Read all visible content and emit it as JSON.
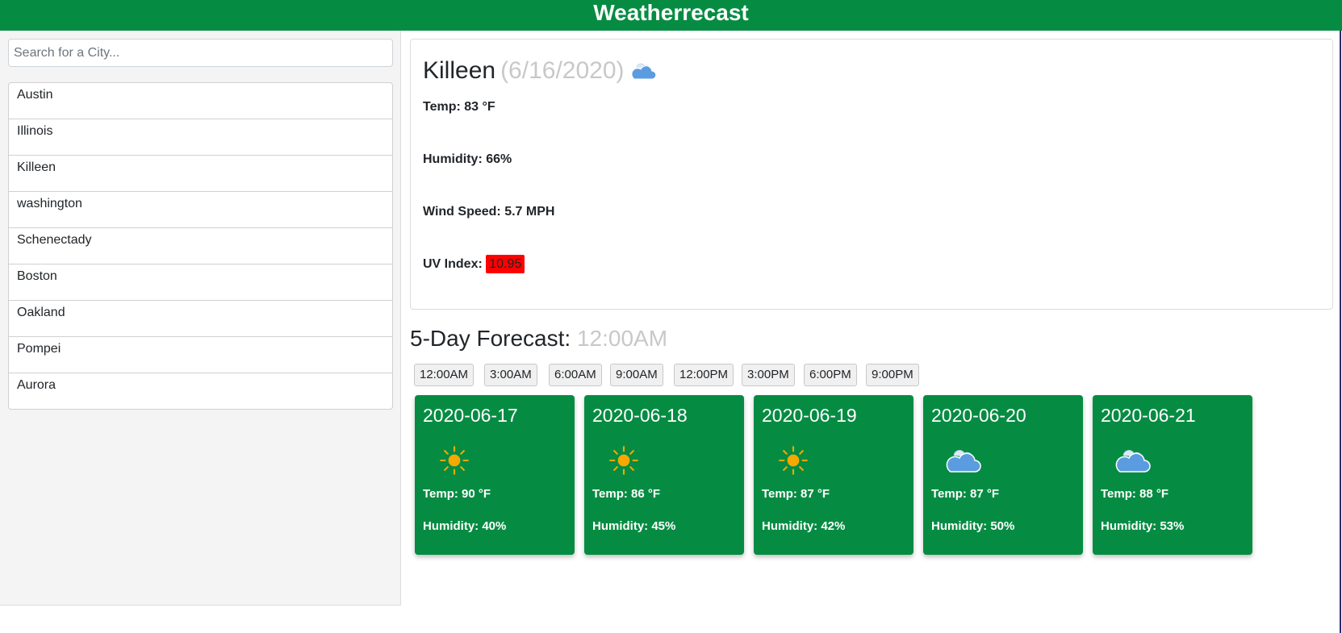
{
  "app": {
    "title": "Weatherrecast"
  },
  "search": {
    "placeholder": "Search for a City..."
  },
  "cities": [
    "Austin",
    "Illinois",
    "Killeen",
    "washington",
    "Schenectady",
    "Boston",
    "Oakland",
    "Pompei",
    "Aurora"
  ],
  "current": {
    "city": "Killeen",
    "date": "(6/16/2020)",
    "icon": "cloud-icon",
    "temp": "Temp: 83 °F",
    "humidity": "Humidity: 66%",
    "wind": "Wind Speed: 5.7 MPH",
    "uv_label": "UV Index:",
    "uv_value": "10.95",
    "uv_color": "#ff0000"
  },
  "forecast": {
    "heading": "5-Day Forecast:",
    "selected_time": "12:00AM",
    "times": [
      "12:00AM",
      "3:00AM",
      "6:00AM",
      "9:00AM",
      "12:00PM",
      "3:00PM",
      "6:00PM",
      "9:00PM"
    ],
    "days": [
      {
        "date": "2020-06-17",
        "icon": "sun-icon",
        "temp": "Temp: 90 °F",
        "humidity": "Humidity: 40%"
      },
      {
        "date": "2020-06-18",
        "icon": "sun-icon",
        "temp": "Temp: 86 °F",
        "humidity": "Humidity: 45%"
      },
      {
        "date": "2020-06-19",
        "icon": "sun-icon",
        "temp": "Temp: 87 °F",
        "humidity": "Humidity: 42%"
      },
      {
        "date": "2020-06-20",
        "icon": "cloud-icon",
        "temp": "Temp: 87 °F",
        "humidity": "Humidity: 50%"
      },
      {
        "date": "2020-06-21",
        "icon": "cloud-icon",
        "temp": "Temp: 88 °F",
        "humidity": "Humidity: 53%"
      }
    ]
  },
  "colors": {
    "brand": "#068c42",
    "muted_text": "#c8c8c8",
    "sun": "#f5a800",
    "cloud": "#5b9be0"
  }
}
